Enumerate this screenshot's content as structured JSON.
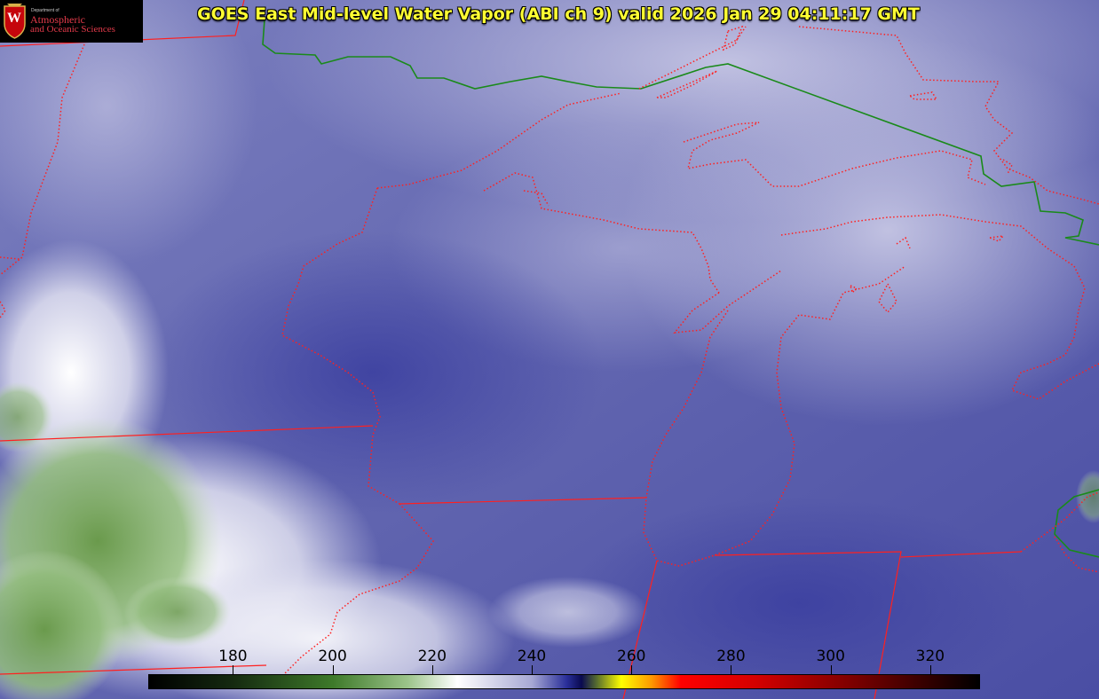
{
  "title": "GOES East Mid-level Water Vapor (ABI ch 9)  valid 2026 Jan 29 04:11:17 GMT",
  "logo": {
    "department": "Department of",
    "line1": "Atmospheric",
    "line2": "and Oceanic Sciences",
    "emblem_letter": "W"
  },
  "colorbar": {
    "ticks": [
      "180",
      "200",
      "220",
      "240",
      "260",
      "280",
      "300",
      "320"
    ],
    "stops": [
      {
        "v": 163,
        "c": "#000000"
      },
      {
        "v": 180,
        "c": "#152a10"
      },
      {
        "v": 200,
        "c": "#3e7a2a"
      },
      {
        "v": 215,
        "c": "#9cc48a"
      },
      {
        "v": 225,
        "c": "#ffffff"
      },
      {
        "v": 240,
        "c": "#a7a8d4"
      },
      {
        "v": 247,
        "c": "#2a2f9a"
      },
      {
        "v": 250,
        "c": "#0a0a50"
      },
      {
        "v": 253,
        "c": "#556b2f"
      },
      {
        "v": 258,
        "c": "#ffff00"
      },
      {
        "v": 264,
        "c": "#ff9a00"
      },
      {
        "v": 270,
        "c": "#ff0000"
      },
      {
        "v": 285,
        "c": "#d40000"
      },
      {
        "v": 305,
        "c": "#7a0000"
      },
      {
        "v": 330,
        "c": "#000000"
      }
    ]
  },
  "colors": {
    "state_borders": "#ff2020",
    "country_border": "#1a8a1a",
    "title_text": "#ffff33"
  }
}
